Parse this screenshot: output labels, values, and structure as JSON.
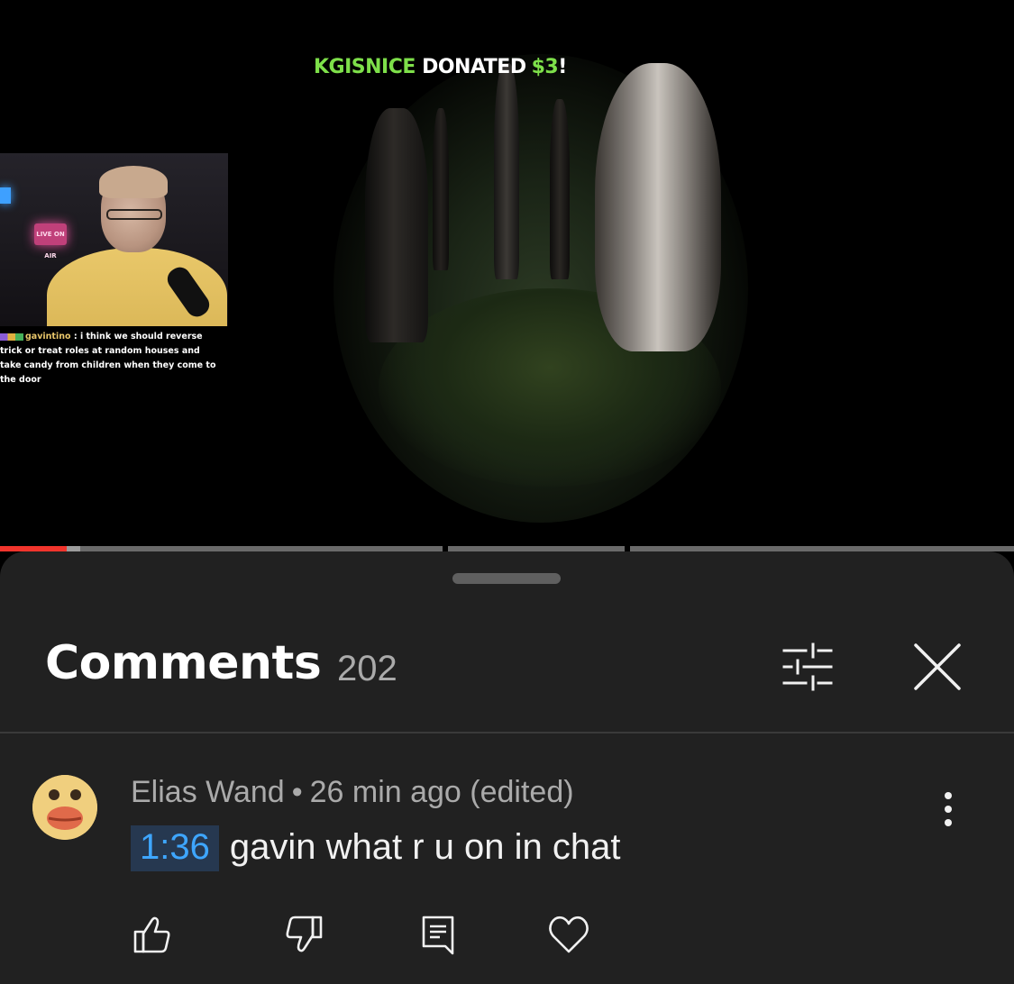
{
  "video": {
    "donation": {
      "donor": "KGISNICE",
      "verb": "DONATED",
      "amount": "$3",
      "bang": "!"
    },
    "webcam": {
      "neon_sign": "LIVE ON AIR"
    },
    "chat_overlay": {
      "username": "gavintino",
      "separator": " : ",
      "message_line1": "i think we should reverse",
      "message_line2": "trick or treat roles at random houses and",
      "message_line3": "take candy from children when they come to",
      "message_line4": "the door"
    },
    "progress": {
      "played_fraction": 0.066,
      "buffered_fraction": 0.079
    }
  },
  "comments_panel": {
    "title": "Comments",
    "count": "202",
    "filter_icon": "sort-filter-icon",
    "close_icon": "close-icon"
  },
  "comment": {
    "author": "Elias Wand",
    "separator": "•",
    "time": "26 min ago (edited)",
    "timestamp": "1:36",
    "text": "gavin what r u on in chat",
    "actions": {
      "like_icon": "thumbs-up-icon",
      "dislike_icon": "thumbs-down-icon",
      "reply_icon": "reply-icon",
      "heart_icon": "heart-icon",
      "more_icon": "more-vertical-icon"
    }
  },
  "colors": {
    "sheet_bg": "#212121",
    "accent_red": "#f1342c",
    "link_blue": "#3ea6ff",
    "donation_green": "#7ee04a"
  }
}
